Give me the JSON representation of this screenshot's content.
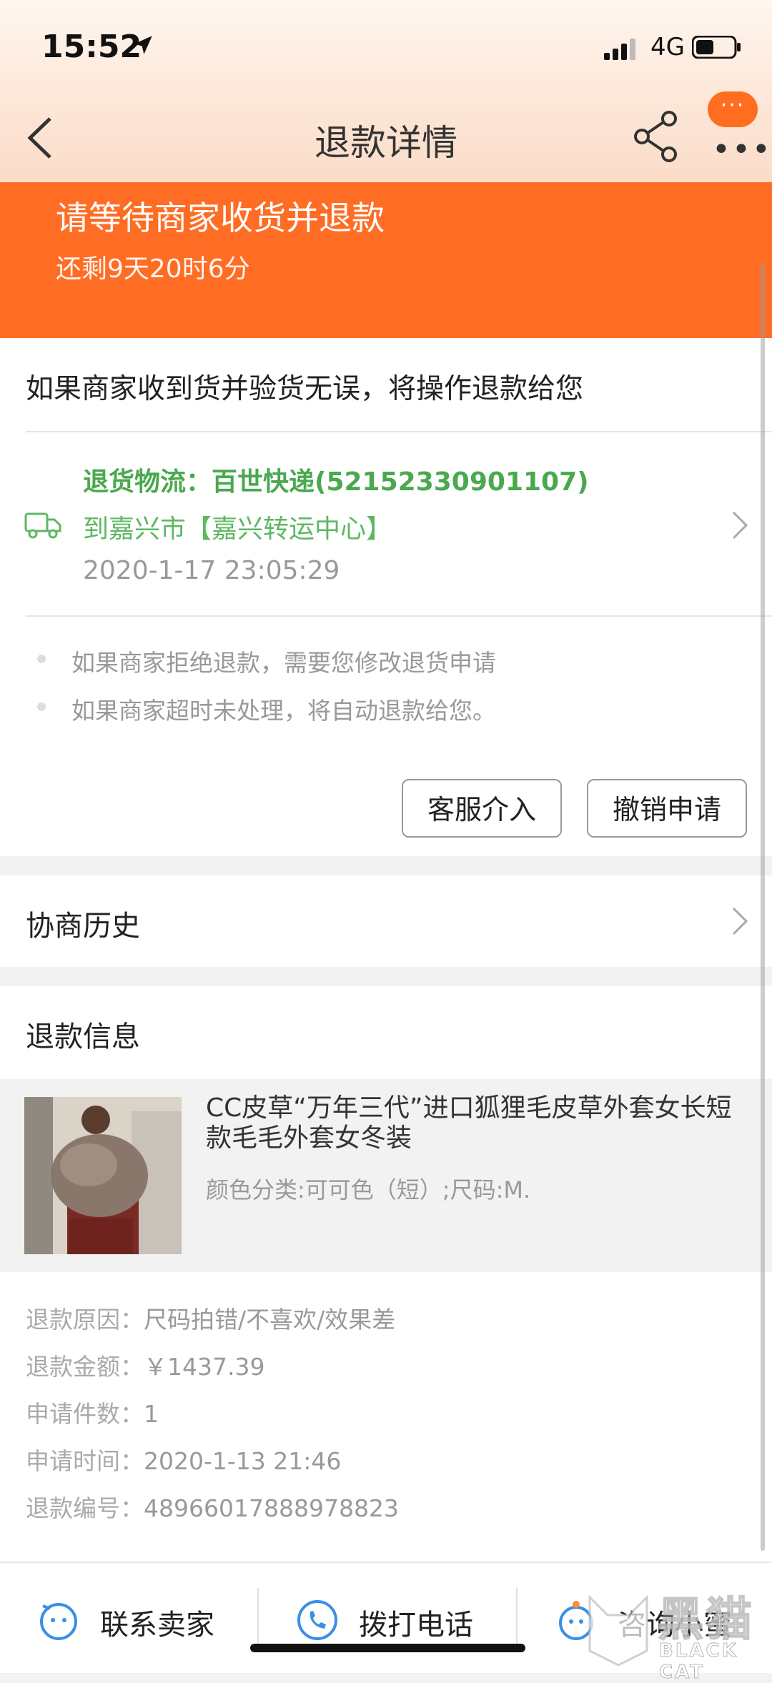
{
  "status_bar": {
    "time": "15:52",
    "network": "4G"
  },
  "nav": {
    "title": "退款详情",
    "more_bubble": "···",
    "more_dots": "•••"
  },
  "banner": {
    "title": "请等待商家收货并退款",
    "countdown": "还剩9天20时6分"
  },
  "notice": "如果商家收到货并验货无误，将操作退款给您",
  "logistics": {
    "line1": "退货物流：百世快递(52152330901107)",
    "line2": "到嘉兴市【嘉兴转运中心】",
    "time": "2020-1-17 23:05:29"
  },
  "tips": [
    "如果商家拒绝退款，需要您修改退货申请",
    "如果商家超时未处理，将自动退款给您。"
  ],
  "actions": {
    "service": "客服介入",
    "cancel": "撤销申请"
  },
  "history": {
    "label": "协商历史"
  },
  "refund_info": {
    "title": "退款信息",
    "product_title": "CC皮草“万年三代”进口狐狸毛皮草外套女长短款毛毛外套女冬装",
    "sku": "颜色分类:可可色（短）;尺码:M.",
    "rows": [
      {
        "key": "退款原因：",
        "value": "尺码拍错/不喜欢/效果差"
      },
      {
        "key": "退款金额：",
        "value": "￥1437.39"
      },
      {
        "key": "申请件数：",
        "value": "1"
      },
      {
        "key": "申请时间：",
        "value": "2020-1-13 21:46"
      },
      {
        "key": "退款编号：",
        "value": "4896601788897882​3"
      }
    ]
  },
  "bottom_bar": {
    "contact": "联系卖家",
    "call": "拨打电话",
    "consult": "咨询小蜜"
  },
  "watermark": {
    "cn": "黑猫",
    "en": "BLACK CAT"
  },
  "colors": {
    "accent": "#ff6d24",
    "logistics_green": "#4aa84f"
  }
}
